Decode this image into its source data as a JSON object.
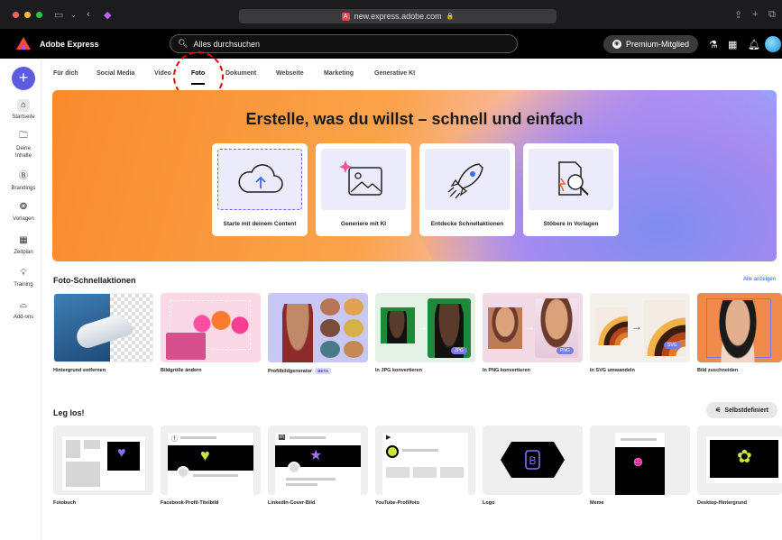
{
  "browser": {
    "url": "new.express.adobe.com",
    "favicon": "adobe-icon"
  },
  "app": {
    "name": "Adobe Express",
    "search_placeholder": "Alles durchsuchen",
    "premium_label": "Premium-Mitglied"
  },
  "sidebar": {
    "items": [
      {
        "label": "Startseite",
        "icon": "home-icon"
      },
      {
        "label": "Deine Inhalte",
        "icon": "folder-icon"
      },
      {
        "label": "Brandings",
        "icon": "brand-icon"
      },
      {
        "label": "Vorlagen",
        "icon": "templates-icon"
      },
      {
        "label": "Zeitplan",
        "icon": "calendar-icon"
      },
      {
        "label": "Training",
        "icon": "lightbulb-icon"
      },
      {
        "label": "Add-ons",
        "icon": "addons-icon"
      }
    ]
  },
  "tabs": [
    "Für dich",
    "Social Media",
    "Video",
    "Foto",
    "Dokument",
    "Webseite",
    "Marketing",
    "Generative KI"
  ],
  "hero": {
    "title": "Erstelle, was du willst – schnell und einfach",
    "cards": [
      {
        "label": "Starte mit deinem Content",
        "icon": "cloud-upload-icon"
      },
      {
        "label": "Generiere mit KI",
        "icon": "image-sparkle-icon"
      },
      {
        "label": "Entdecke Schnellaktionen",
        "icon": "rocket-icon"
      },
      {
        "label": "Stöbere in Vorlagen",
        "icon": "search-document-icon"
      }
    ]
  },
  "quick": {
    "title": "Foto-Schnellaktionen",
    "see_all": "Alle anzeigen",
    "items": [
      {
        "label": "Hintergrund entfernen"
      },
      {
        "label": "Bildgröße ändern"
      },
      {
        "label": "Profilbildgenerator",
        "badge": "BETA"
      },
      {
        "label": "In JPG konvertieren",
        "badge": "JPG"
      },
      {
        "label": "In PNG konvertieren",
        "badge": "PNG"
      },
      {
        "label": "In SVG umwandeln",
        "badge": "SVG"
      },
      {
        "label": "Bild zuschneiden"
      }
    ]
  },
  "start": {
    "title": "Leg los!",
    "custom_label": "Selbstdefiniert",
    "items": [
      "Fotobuch",
      "Facebook-Profil-Titelbild",
      "LinkedIn-Cover-Bild",
      "YouTube-Profilfoto",
      "Logo",
      "Meme",
      "Desktop-Hintergrund"
    ]
  },
  "colors": {
    "accent": "#5c5ce0",
    "annotation": "#e00000"
  }
}
